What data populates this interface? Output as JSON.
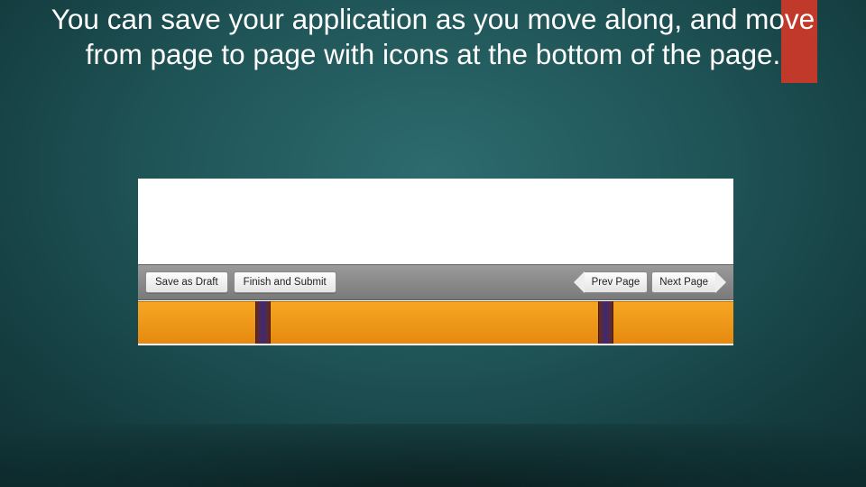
{
  "accent_color": "#c0392b",
  "headline": "You can save your application as you move along, and move from page to page with icons at the bottom of the page.",
  "toolbar": {
    "save_draft_label": "Save as Draft",
    "finish_submit_label": "Finish and Submit",
    "prev_page_label": "Prev Page",
    "next_page_label": "Next Page"
  }
}
